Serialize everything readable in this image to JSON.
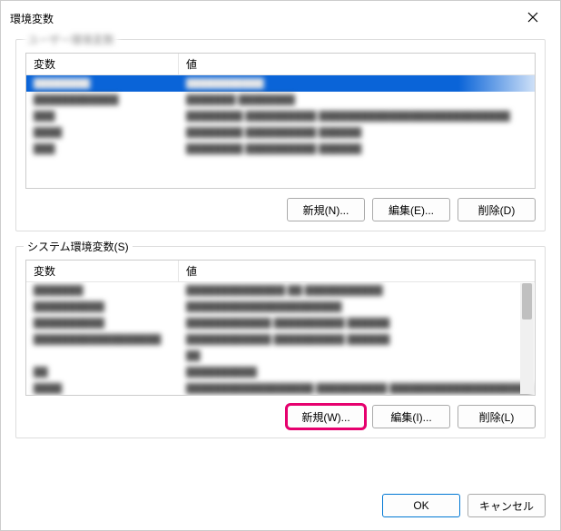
{
  "window": {
    "title": "環境変数"
  },
  "userGroup": {
    "label": "ユーザー環境変数",
    "header_var": "変数",
    "header_val": "値",
    "buttons": {
      "new": "新規(N)...",
      "edit": "編集(E)...",
      "delete": "削除(D)"
    }
  },
  "systemGroup": {
    "label": "システム環境変数(S)",
    "header_var": "変数",
    "header_val": "値",
    "buttons": {
      "new": "新規(W)...",
      "edit": "編集(I)...",
      "delete": "削除(L)"
    }
  },
  "footer": {
    "ok": "OK",
    "cancel": "キャンセル"
  }
}
